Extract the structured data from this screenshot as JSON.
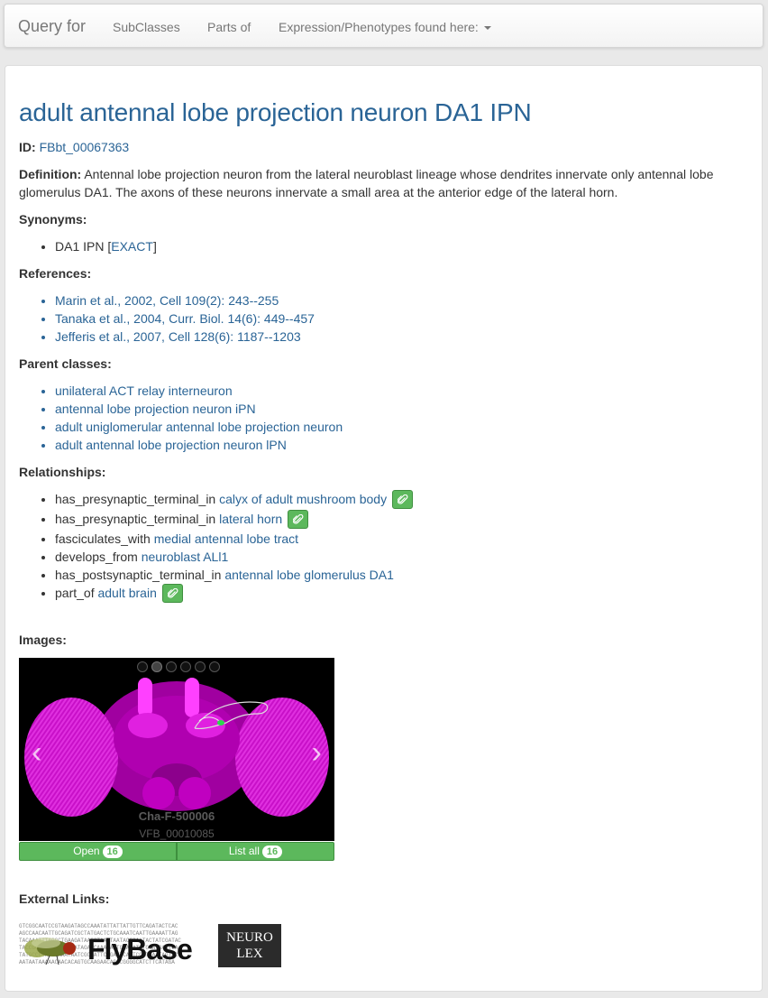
{
  "nav": {
    "brand": "Query for",
    "items": [
      "SubClasses",
      "Parts of",
      "Expression/Phenotypes found here:"
    ]
  },
  "term": {
    "title": "adult antennal lobe projection neuron DA1 IPN",
    "id_label": "ID:",
    "id_value": "FBbt_00067363",
    "definition_label": "Definition:",
    "definition_text": "Antennal lobe projection neuron from the lateral neuroblast lineage whose dendrites innervate only antennal lobe glomerulus DA1. The axons of these neurons innervate a small area at the anterior edge of the lateral horn."
  },
  "synonyms": {
    "heading": "Synonyms:",
    "items": [
      {
        "text": "DA1 IPN [",
        "link": "EXACT",
        "suffix": "]"
      }
    ]
  },
  "references": {
    "heading": "References:",
    "items": [
      "Marin et al., 2002, Cell 109(2): 243--255",
      "Tanaka et al., 2004, Curr. Biol. 14(6): 449--457",
      "Jefferis et al., 2007, Cell 128(6): 1187--1203"
    ]
  },
  "parents": {
    "heading": "Parent classes:",
    "items": [
      "unilateral ACT relay interneuron",
      "antennal lobe projection neuron iPN",
      "adult uniglomerular antennal lobe projection neuron",
      "adult antennal lobe projection neuron lPN"
    ]
  },
  "relationships": {
    "heading": "Relationships:",
    "items": [
      {
        "rel": "has_presynaptic_terminal_in",
        "target": "calyx of adult mushroom body",
        "clip": true
      },
      {
        "rel": "has_presynaptic_terminal_in",
        "target": "lateral horn",
        "clip": true
      },
      {
        "rel": "fasciculates_with",
        "target": "medial antennal lobe tract",
        "clip": false
      },
      {
        "rel": "develops_from",
        "target": "neuroblast ALl1",
        "clip": false
      },
      {
        "rel": "has_postsynaptic_terminal_in",
        "target": "antennal lobe glomerulus DA1",
        "clip": false
      },
      {
        "rel": "part_of",
        "target": "adult brain",
        "clip": true
      }
    ]
  },
  "images": {
    "heading": "Images:",
    "caption_name": "Cha-F-500006",
    "caption_id": "VFB_00010085",
    "open_label": "Open",
    "open_count": "16",
    "list_label": "List all",
    "list_count": "16"
  },
  "external": {
    "heading": "External Links:",
    "flybase_label": "FlyBase",
    "flybase_dna": [
      "GTCGGCAATCCGTAAGATAGCCAAATATTATTATTGTTCAGATACTCAC",
      "AGCCAACAATTGCAGATCGCTATGACTCTGCAAATCAATTGAAAATTAG",
      "TACAAATTTAGGCTGAAGATAACCTAATTAATACCCAATACTATCGATAC",
      "TACCGCCTAATAGATAGATAGATCAAAAATTCGAAATTTCGATGAATGA",
      "TATGCCCTATTTAAATAATCGCCATTCCGAGTCAATCCATTAATAGTAC",
      "AATAATAAAAACAACACAGTGCAAGAACAGCCGGGGCATCTTCATAGA"
    ],
    "neurolex_line1": "NEURO",
    "neurolex_line2": "LEX"
  },
  "colors": {
    "link": "#2a6496",
    "button_green": "#5cb85c",
    "brain_magenta": "#d400d4"
  }
}
